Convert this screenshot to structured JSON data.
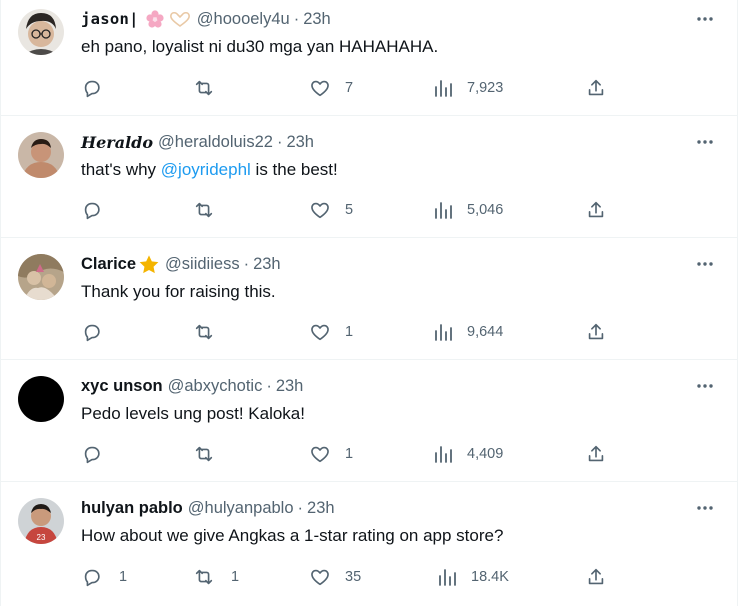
{
  "tweets": [
    {
      "name": "jason|",
      "handle": "@hoooely4u",
      "dot": "·",
      "time": "23h",
      "text": "eh pano, loyalist ni du30 mga yan HAHAHAHA.",
      "replies": "",
      "retweets": "",
      "likes": "7",
      "views": "7,923",
      "badge_icons": [
        "cherry-blossom-icon",
        "heart-hands-icon"
      ]
    },
    {
      "name": "Heraldo",
      "handle": "@heraldoluis22",
      "dot": "·",
      "time": "23h",
      "text_before": "that's why ",
      "mention": "@joyridephl",
      "text_after": " is the best!",
      "replies": "",
      "retweets": "",
      "likes": "5",
      "views": "5,046"
    },
    {
      "name": "Clarice",
      "handle": "@siidiiess",
      "dot": "·",
      "time": "23h",
      "text": "Thank you for raising this.",
      "replies": "",
      "retweets": "",
      "likes": "1",
      "views": "9,644",
      "badge_icons": [
        "star-icon"
      ]
    },
    {
      "name": "xyc unson",
      "handle": "@abxychotic",
      "dot": "·",
      "time": "23h",
      "text": "Pedo levels ung post! Kaloka!",
      "replies": "",
      "retweets": "",
      "likes": "1",
      "views": "4,409"
    },
    {
      "name": "hulyan pablo",
      "handle": "@hulyanpablo",
      "dot": "·",
      "time": "23h",
      "text": "How about we give Angkas a 1-star rating on app store?",
      "replies": "1",
      "retweets": "1",
      "likes": "35",
      "views": "18.4K"
    }
  ],
  "colors": {
    "text": "#0f1419",
    "secondary": "#536471",
    "link": "#1d9bf0",
    "divider": "#eff3f4",
    "star": "#f4b400"
  }
}
